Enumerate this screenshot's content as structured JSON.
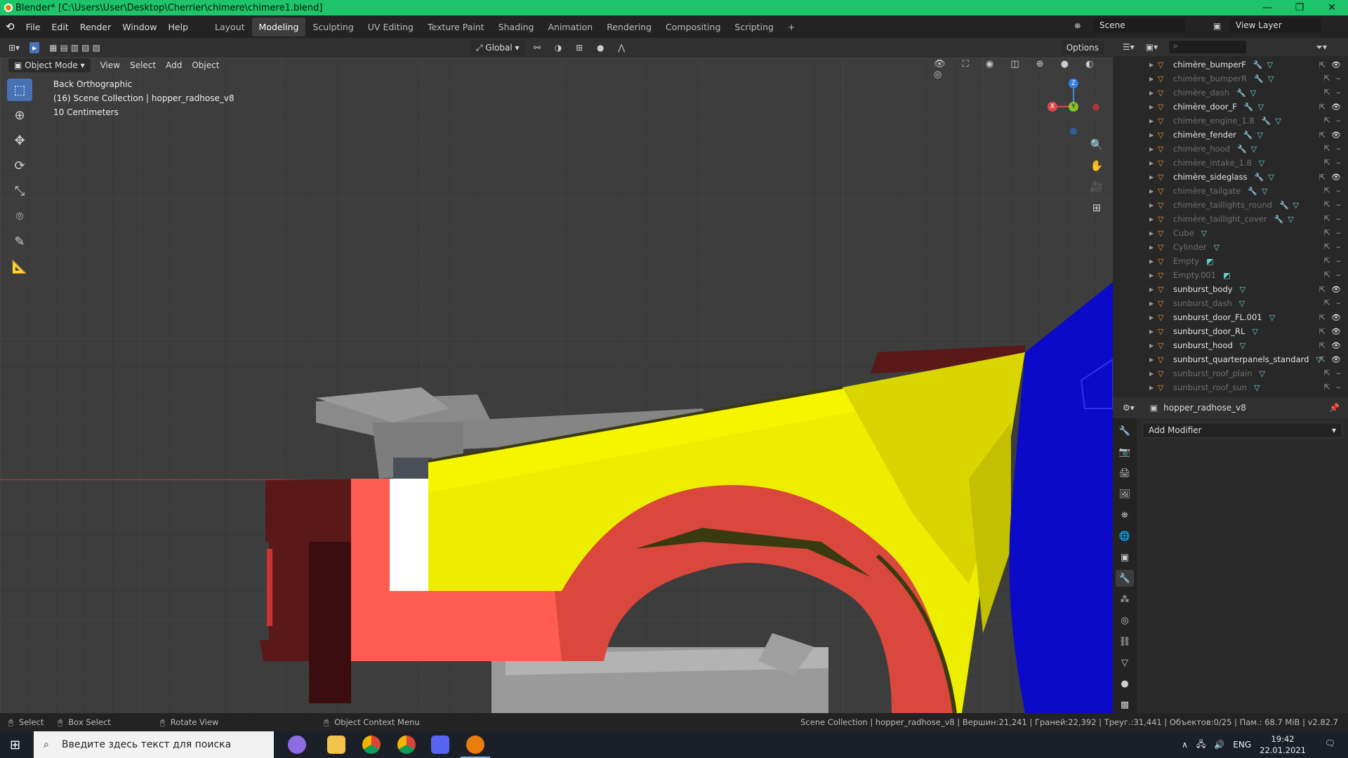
{
  "window": {
    "title": "Blender* [C:\\Users\\User\\Desktop\\Cherrier\\chimere\\chimere1.blend]",
    "controls": [
      "—",
      "❐",
      "✕"
    ]
  },
  "menu": [
    "File",
    "Edit",
    "Render",
    "Window",
    "Help"
  ],
  "workspaces": [
    "Layout",
    "Modeling",
    "Sculpting",
    "UV Editing",
    "Texture Paint",
    "Shading",
    "Animation",
    "Rendering",
    "Compositing",
    "Scripting",
    "+"
  ],
  "active_workspace": "Modeling",
  "scene": "Scene",
  "view_layer": "View Layer",
  "header": {
    "transform": "Global",
    "options": "Options",
    "mode": "Object Mode",
    "menus": [
      "View",
      "Select",
      "Add",
      "Object"
    ]
  },
  "viewport": {
    "view_name": "Back Orthographic",
    "collection": "(16) Scene Collection | hopper_radhose_v8",
    "scale": "10 Centimeters",
    "gizmo": {
      "x": "X",
      "y": "Y",
      "z": "Z"
    }
  },
  "outliner": {
    "items": [
      {
        "name": "chimère_bumperF",
        "lit": true,
        "mods": [
          "🔧",
          "▽"
        ],
        "visible": true
      },
      {
        "name": "chimère_bumperR",
        "lit": false,
        "mods": [
          "🔧",
          "▽"
        ],
        "visible": false
      },
      {
        "name": "chimère_dash",
        "lit": false,
        "mods": [
          "🔧",
          "▽"
        ],
        "visible": false
      },
      {
        "name": "chimère_door_F",
        "lit": true,
        "mods": [
          "🔧",
          "▽"
        ],
        "visible": true
      },
      {
        "name": "chimère_engine_1.8",
        "lit": false,
        "mods": [
          "🔧",
          "▽"
        ],
        "visible": false
      },
      {
        "name": "chimère_fender",
        "lit": true,
        "mods": [
          "🔧",
          "▽"
        ],
        "visible": true
      },
      {
        "name": "chimère_hood",
        "lit": false,
        "mods": [
          "🔧",
          "▽"
        ],
        "visible": false
      },
      {
        "name": "chimère_intake_1.8",
        "lit": false,
        "mods": [
          "▽"
        ],
        "visible": false
      },
      {
        "name": "chimère_sideglass",
        "lit": true,
        "mods": [
          "🔧",
          "▽"
        ],
        "visible": true
      },
      {
        "name": "chimère_tailgate",
        "lit": false,
        "mods": [
          "🔧",
          "▽"
        ],
        "visible": false
      },
      {
        "name": "chimère_taillights_round",
        "lit": false,
        "mods": [
          "🔧",
          "▽"
        ],
        "visible": false
      },
      {
        "name": "chimère_taillight_cover",
        "lit": false,
        "mods": [
          "🔧",
          "▽"
        ],
        "visible": false
      },
      {
        "name": "Cube",
        "lit": false,
        "mods": [
          "▽"
        ],
        "visible": false
      },
      {
        "name": "Cylinder",
        "lit": false,
        "mods": [
          "▽"
        ],
        "visible": false
      },
      {
        "name": "Empty",
        "lit": false,
        "mods": [
          "◩"
        ],
        "visible": false
      },
      {
        "name": "Empty.001",
        "lit": false,
        "mods": [
          "◩"
        ],
        "visible": false
      },
      {
        "name": "sunburst_body",
        "lit": true,
        "mods": [
          "▽"
        ],
        "visible": true
      },
      {
        "name": "sunburst_dash",
        "lit": false,
        "mods": [
          "▽"
        ],
        "visible": false
      },
      {
        "name": "sunburst_door_FL.001",
        "lit": true,
        "mods": [
          "▽"
        ],
        "visible": true
      },
      {
        "name": "sunburst_door_RL",
        "lit": true,
        "mods": [
          "▽"
        ],
        "visible": true
      },
      {
        "name": "sunburst_hood",
        "lit": true,
        "mods": [
          "▽"
        ],
        "visible": true
      },
      {
        "name": "sunburst_quarterpanels_standard",
        "lit": true,
        "mods": [
          "▽"
        ],
        "visible": true
      },
      {
        "name": "sunburst_roof_plain",
        "lit": false,
        "mods": [
          "▽"
        ],
        "visible": false
      },
      {
        "name": "sunburst_roof_sun",
        "lit": false,
        "mods": [
          "▽"
        ],
        "visible": false
      }
    ]
  },
  "properties": {
    "object": "hopper_radhose_v8",
    "add_modifier": "Add Modifier"
  },
  "status": {
    "select": "Select",
    "box_select": "Box Select",
    "rotate": "Rotate View",
    "context": "Object Context Menu",
    "stats": "Scene Collection | hopper_radhose_v8 | Вершин:21,241 | Граней:22,392 | Треуг.:31,441 | Объектов:0/25 | Пам.: 68.7 MiB | v2.82.7"
  },
  "taskbar": {
    "search_placeholder": "Введите здесь текст для поиска",
    "lang": "ENG",
    "time": "19:42",
    "date": "22.01.2021"
  }
}
